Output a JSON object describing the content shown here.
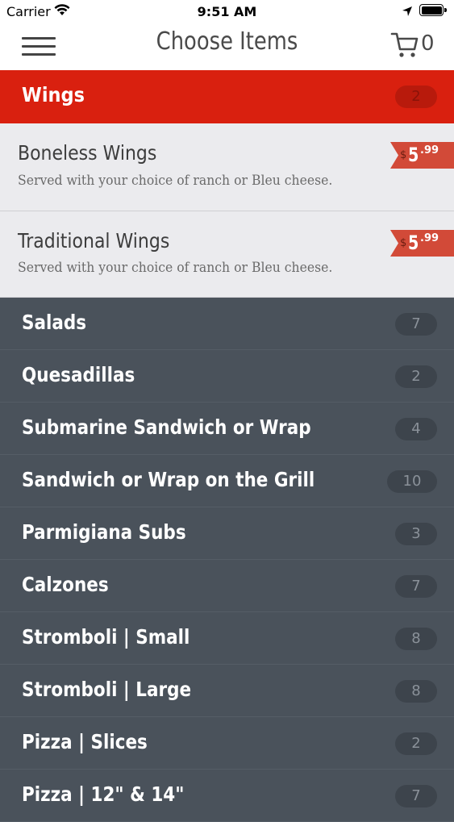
{
  "status_bar": {
    "carrier": "Carrier",
    "time": "9:51 AM",
    "icons": [
      "wifi-icon",
      "location-icon",
      "battery-icon"
    ]
  },
  "nav": {
    "title": "Choose Items",
    "cart_count": "0",
    "icons": [
      "menu-icon",
      "cart-icon"
    ]
  },
  "colors": {
    "accent_red": "#d9200f",
    "price_red": "#d24a38",
    "category_bg": "#4a525b",
    "item_bg": "#ebebee"
  },
  "expanded_section": {
    "label": "Wings",
    "count": "2",
    "items": [
      {
        "name": "Boneless Wings",
        "description": "Served with your choice of ranch or Bleu cheese.",
        "currency": "$",
        "price_dollars": "5",
        "price_cents": ".99"
      },
      {
        "name": "Traditional Wings",
        "description": "Served with your choice of ranch or Bleu cheese.",
        "currency": "$",
        "price_dollars": "5",
        "price_cents": ".99"
      }
    ]
  },
  "categories": [
    {
      "label": "Salads",
      "count": "7"
    },
    {
      "label": "Quesadillas",
      "count": "2"
    },
    {
      "label": "Submarine Sandwich or Wrap",
      "count": "4"
    },
    {
      "label": "Sandwich or Wrap on the Grill",
      "count": "10"
    },
    {
      "label": "Parmigiana Subs",
      "count": "3"
    },
    {
      "label": "Calzones",
      "count": "7"
    },
    {
      "label": "Stromboli | Small",
      "count": "8"
    },
    {
      "label": "Stromboli | Large",
      "count": "8"
    },
    {
      "label": "Pizza | Slices",
      "count": "2"
    },
    {
      "label": "Pizza | 12\" & 14\"",
      "count": "7"
    }
  ]
}
